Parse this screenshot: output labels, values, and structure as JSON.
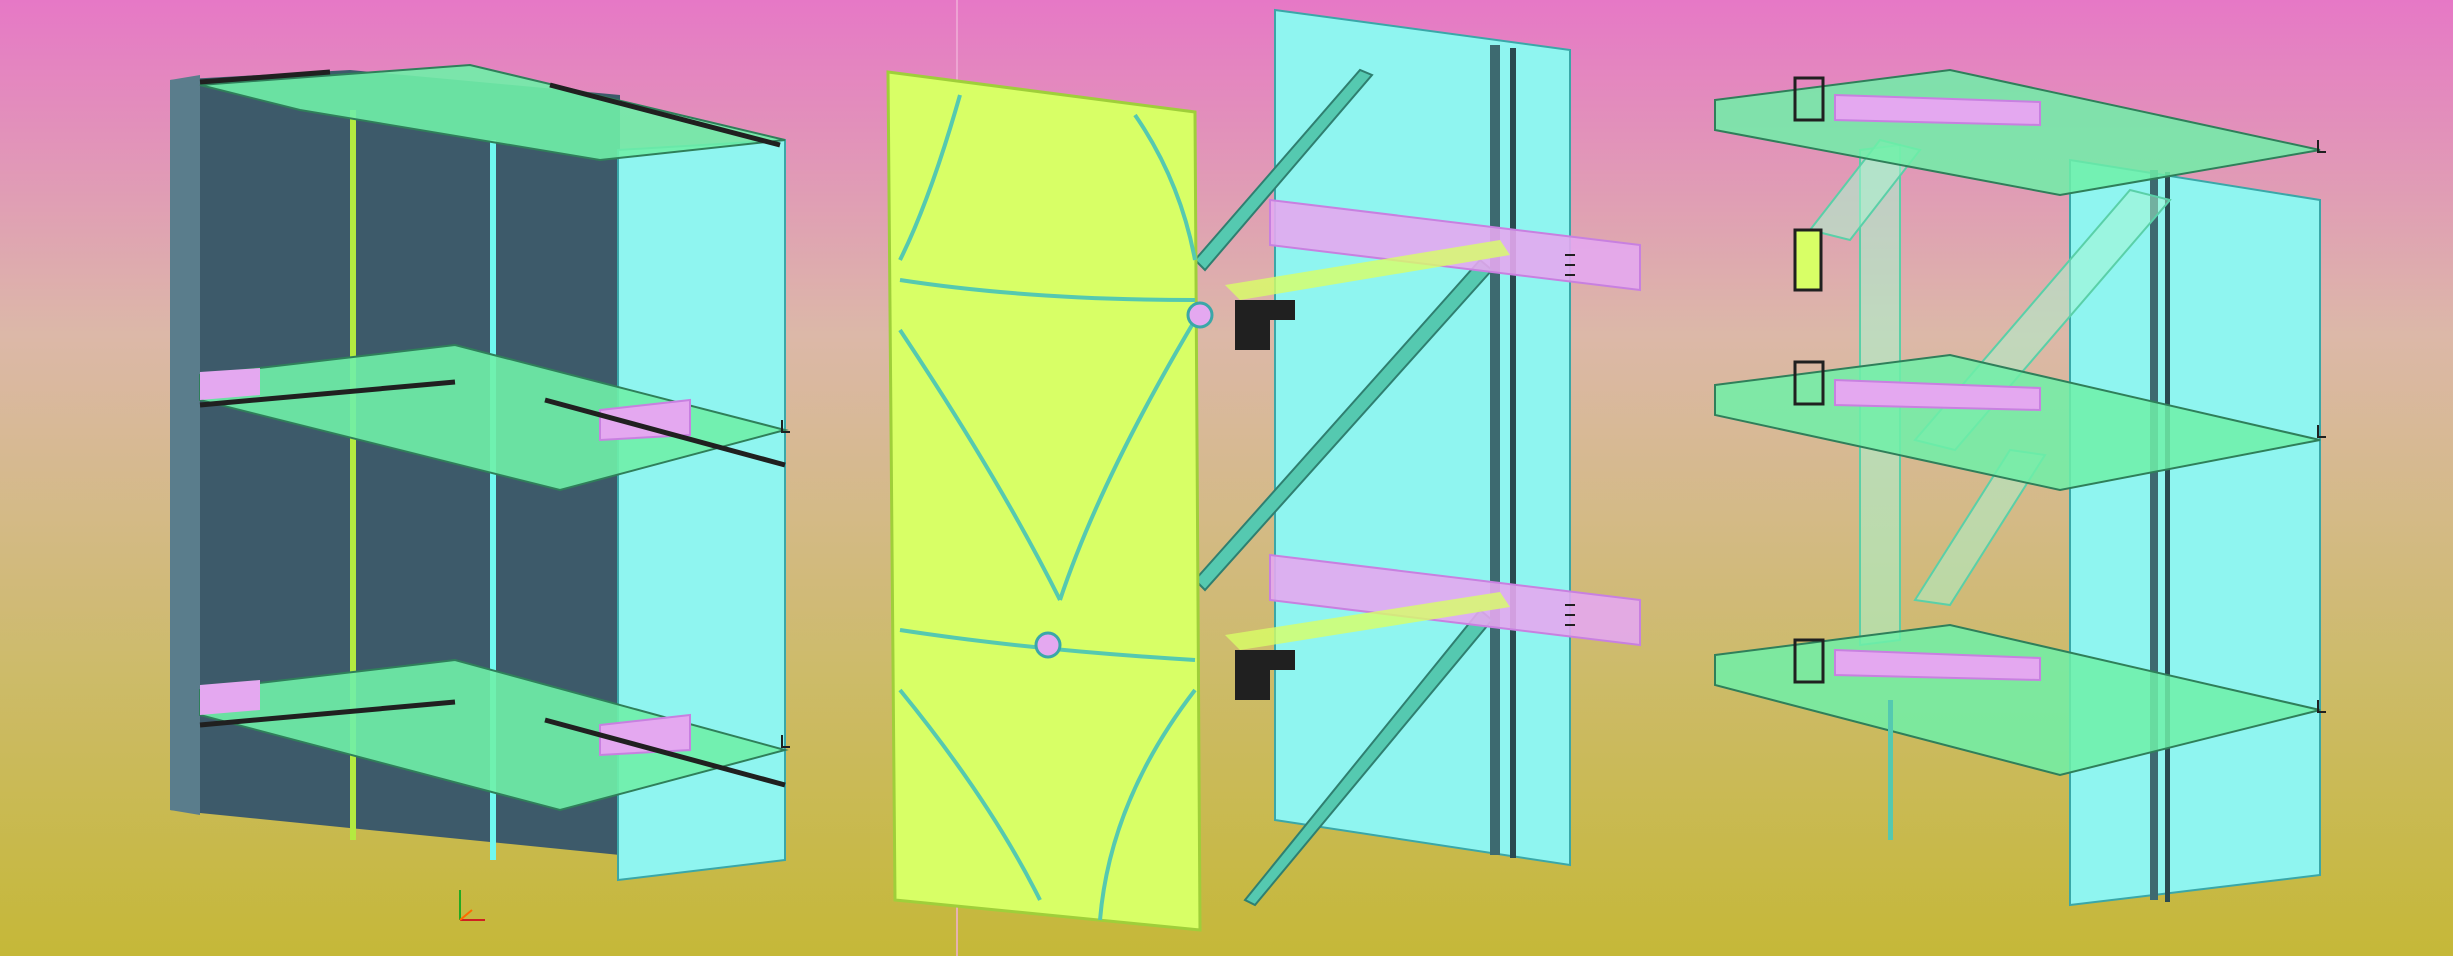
{
  "viewport": {
    "background_gradient": [
      "#e678c6",
      "#dcb8a8",
      "#cdbb6a",
      "#c5b838"
    ],
    "divider_color": "#f0b0d8"
  },
  "colors": {
    "slab_fill": "#6ff0a8",
    "slab_edge": "#2f7f5a",
    "dark_panel": "#3d5a6a",
    "glass": "#8ff5f0",
    "glass_edge": "#3aa7a8",
    "mullion": "#4fd3c8",
    "violet": "#e4a8f0",
    "violet_dark": "#c880e0",
    "lime": "#d8ff66",
    "lime_edge": "#9fcf3a",
    "bracket": "#202020",
    "brace": "#55c9b0"
  },
  "axis_triad": {
    "icon": "xyz-axis-triad-icon",
    "colors": [
      "#ff6a00",
      "#22aa22",
      "#d02020"
    ]
  },
  "assemblies": [
    {
      "id": "opaque-spandrel-module",
      "icon": "curtain-wall-module-icon"
    },
    {
      "id": "perforated-screen-module",
      "icon": "facade-screen-icon"
    },
    {
      "id": "glazed-structural-module",
      "icon": "glazing-frame-icon"
    }
  ]
}
